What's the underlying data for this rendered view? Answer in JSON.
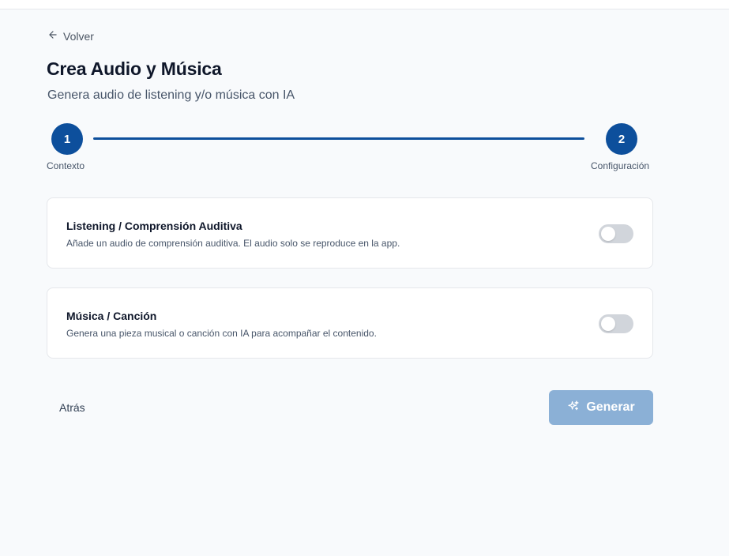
{
  "nav": {
    "back_link": "Volver",
    "back_icon": "arrow-left-icon"
  },
  "header": {
    "title": "Crea Audio y Música",
    "subtitle": "Genera audio de listening y/o música con IA"
  },
  "stepper": {
    "steps": [
      {
        "number": "1",
        "label": "Contexto"
      },
      {
        "number": "2",
        "label": "Configuración"
      }
    ],
    "current_step": 2,
    "accent_color": "#0d4f9c"
  },
  "options": [
    {
      "title": "Listening / Comprensión Auditiva",
      "description": "Añade un audio de comprensión auditiva. El audio solo se reproduce en la app.",
      "enabled": false
    },
    {
      "title": "Música / Canción",
      "description": "Genera una pieza musical o canción con IA para acompañar el contenido.",
      "enabled": false
    }
  ],
  "actions": {
    "back_label": "Atrás",
    "generate_label": "Generar",
    "generate_icon": "sparkles-icon",
    "generate_disabled": true
  }
}
